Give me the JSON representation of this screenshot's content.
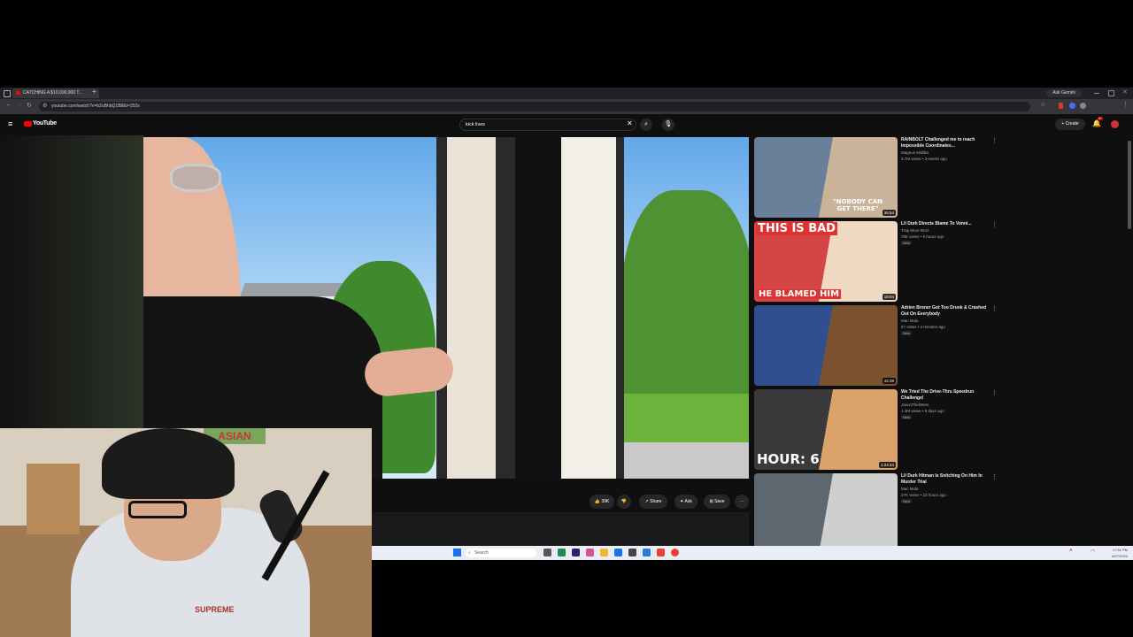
{
  "browser": {
    "tab_title": "CATCHING A $10,000,000 T...",
    "new_tab": "+",
    "url": "youtube.com/watch?v=b2uBhbQ1B8&t=252s",
    "gemini_label": "Ask Gemini"
  },
  "youtube": {
    "logo_text": "YouTube",
    "search_value": "kick lives",
    "create_label": "Create",
    "notification_count": "9+"
  },
  "video": {
    "like_count": "39K",
    "share_label": "Share",
    "ask_label": "Ask",
    "save_label": "Save"
  },
  "recommendations": [
    {
      "title": "RAINBOLT Challenged me to reach Impossible Coordinates...",
      "channel": "Magnus Midtbø",
      "meta": "3.7M views • 3 weeks ago",
      "duration": "36:54",
      "new": "",
      "thumb_text": "\"NOBODY CAN GET THERE\"",
      "colors": [
        "#6a7f99",
        "#c9b49a"
      ]
    },
    {
      "title": "Lil Durk Directs Blame To Vonni...",
      "channel": "Trap More Rerz",
      "meta": "70K views • 5 hours ago",
      "duration": "18:04",
      "new": "New",
      "thumb_text": "THIS IS BAD",
      "thumb_text2": "HE BLAMED HIM",
      "colors": [
        "#d64545",
        "#f0d9c2"
      ]
    },
    {
      "title": "Adrien Broner Got Too Drunk & Crashed Out On Everybody",
      "channel": "Mac Mula",
      "meta": "67 views • 4 minutes ago",
      "duration": "42:39",
      "new": "New",
      "thumb_text": "",
      "colors": [
        "#2f4f8f",
        "#7a5230"
      ]
    },
    {
      "title": "We Tried The Drive-Thru Speedrun Challenge!",
      "channel": "JasonTheWeen",
      "meta": "1.3M views • 6 days ago",
      "duration": "1:24:44",
      "new": "New",
      "thumb_text": "HOUR: 6",
      "colors": [
        "#3a3a3a",
        "#d9a36a"
      ]
    },
    {
      "title": "Lil Durk Hitman Is Snitching On Him In Murder Trial",
      "channel": "Mac Mula",
      "meta": "27K views • 22 hours ago",
      "duration": "",
      "new": "New",
      "thumb_text": "",
      "colors": [
        "#5d6770",
        "#cfcfcf"
      ]
    }
  ],
  "taskbar": {
    "search_placeholder": "Search",
    "time": "17:51 PM",
    "date": "6/27/2024"
  },
  "webcam": {
    "banner_text": "ASIAN",
    "hoodie_text": "SUPREME"
  }
}
